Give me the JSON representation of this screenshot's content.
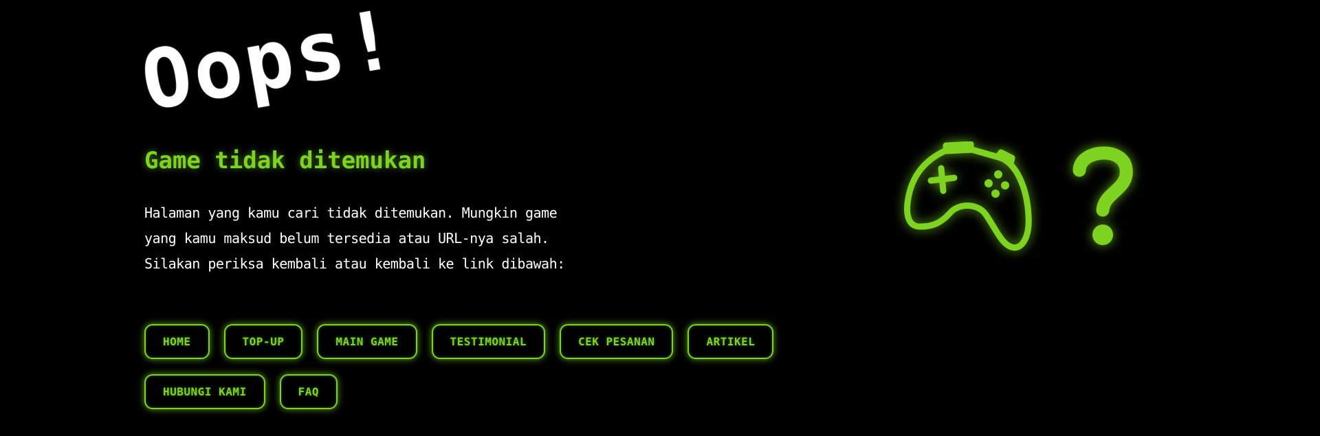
{
  "hero": {
    "title": "Oops!",
    "subtitle": "Game tidak ditemukan",
    "description": "Halaman yang kamu cari tidak ditemukan. Mungkin game yang kamu maksud belum tersedia atau URL-nya salah. Silakan periksa kembali atau kembali ke link dibawah:"
  },
  "nav": {
    "home": "HOME",
    "topup": "TOP-UP",
    "main_game": "MAIN GAME",
    "testimonial": "TESTIMONIAL",
    "cek_pesanan": "CEK PESANAN",
    "artikel": "ARTIKEL",
    "hubungi_kami": "HUBUNGI KAMI",
    "faq": "FAQ"
  },
  "illustration": {
    "icons": [
      "gamepad-icon",
      "question-icon"
    ]
  },
  "colors": {
    "background": "#000000",
    "accent": "#7ed321",
    "text": "#ffffff"
  }
}
